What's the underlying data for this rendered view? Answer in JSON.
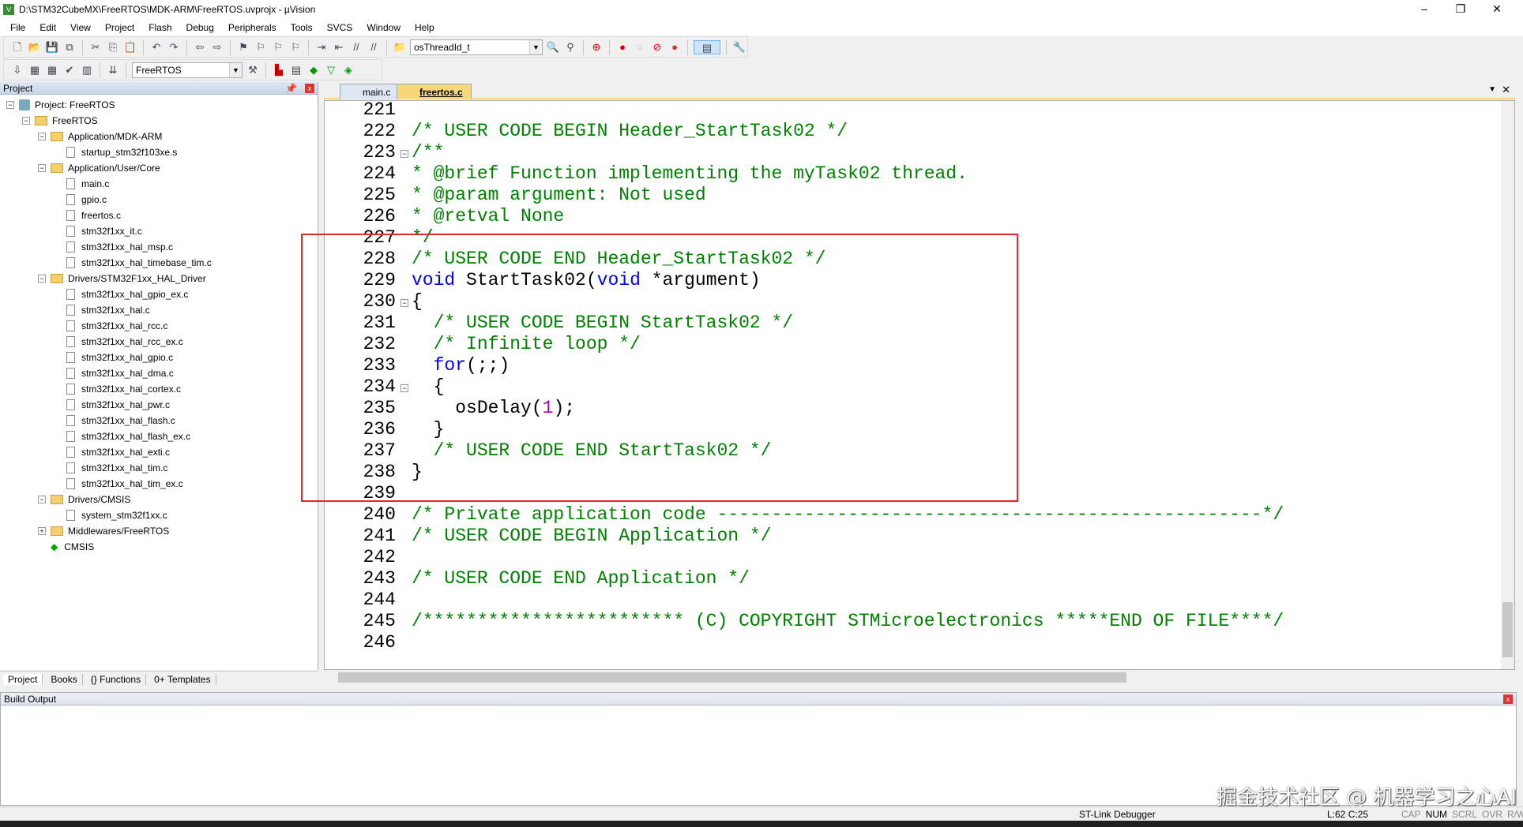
{
  "window": {
    "title": "D:\\STM32CubeMX\\FreeRTOS\\MDK-ARM\\FreeRTOS.uvprojx - µVision"
  },
  "menu": [
    "File",
    "Edit",
    "View",
    "Project",
    "Flash",
    "Debug",
    "Peripherals",
    "Tools",
    "SVCS",
    "Window",
    "Help"
  ],
  "toolbar": {
    "find_combo": "osThreadId_t",
    "target_combo": "FreeRTOS"
  },
  "project_panel": {
    "title": "Project",
    "tree": [
      {
        "label": "Project: FreeRTOS",
        "level": 0,
        "type": "root",
        "toggle": "-"
      },
      {
        "label": "FreeRTOS",
        "level": 1,
        "type": "folder",
        "toggle": "-"
      },
      {
        "label": "Application/MDK-ARM",
        "level": 2,
        "type": "folder",
        "toggle": "-"
      },
      {
        "label": "startup_stm32f103xe.s",
        "level": 3,
        "type": "file"
      },
      {
        "label": "Application/User/Core",
        "level": 2,
        "type": "folder",
        "toggle": "-"
      },
      {
        "label": "main.c",
        "level": 3,
        "type": "file"
      },
      {
        "label": "gpio.c",
        "level": 3,
        "type": "file"
      },
      {
        "label": "freertos.c",
        "level": 3,
        "type": "file"
      },
      {
        "label": "stm32f1xx_it.c",
        "level": 3,
        "type": "file"
      },
      {
        "label": "stm32f1xx_hal_msp.c",
        "level": 3,
        "type": "file"
      },
      {
        "label": "stm32f1xx_hal_timebase_tim.c",
        "level": 3,
        "type": "file"
      },
      {
        "label": "Drivers/STM32F1xx_HAL_Driver",
        "level": 2,
        "type": "folder",
        "toggle": "-"
      },
      {
        "label": "stm32f1xx_hal_gpio_ex.c",
        "level": 3,
        "type": "file"
      },
      {
        "label": "stm32f1xx_hal.c",
        "level": 3,
        "type": "file"
      },
      {
        "label": "stm32f1xx_hal_rcc.c",
        "level": 3,
        "type": "file"
      },
      {
        "label": "stm32f1xx_hal_rcc_ex.c",
        "level": 3,
        "type": "file"
      },
      {
        "label": "stm32f1xx_hal_gpio.c",
        "level": 3,
        "type": "file"
      },
      {
        "label": "stm32f1xx_hal_dma.c",
        "level": 3,
        "type": "file"
      },
      {
        "label": "stm32f1xx_hal_cortex.c",
        "level": 3,
        "type": "file"
      },
      {
        "label": "stm32f1xx_hal_pwr.c",
        "level": 3,
        "type": "file"
      },
      {
        "label": "stm32f1xx_hal_flash.c",
        "level": 3,
        "type": "file"
      },
      {
        "label": "stm32f1xx_hal_flash_ex.c",
        "level": 3,
        "type": "file"
      },
      {
        "label": "stm32f1xx_hal_exti.c",
        "level": 3,
        "type": "file"
      },
      {
        "label": "stm32f1xx_hal_tim.c",
        "level": 3,
        "type": "file"
      },
      {
        "label": "stm32f1xx_hal_tim_ex.c",
        "level": 3,
        "type": "file"
      },
      {
        "label": "Drivers/CMSIS",
        "level": 2,
        "type": "folder",
        "toggle": "-"
      },
      {
        "label": "system_stm32f1xx.c",
        "level": 3,
        "type": "file"
      },
      {
        "label": "Middlewares/FreeRTOS",
        "level": 2,
        "type": "folder",
        "toggle": "+"
      },
      {
        "label": "CMSIS",
        "level": 2,
        "type": "component"
      }
    ],
    "bottom_tabs": [
      "Project",
      "Books",
      "{} Functions",
      "0+ Templates"
    ]
  },
  "editor": {
    "tabs": [
      {
        "label": "main.c",
        "active": false
      },
      {
        "label": "freertos.c",
        "active": true
      }
    ],
    "lines": [
      {
        "n": "221",
        "html": ""
      },
      {
        "n": "222",
        "html": "<span class='cm'>/* USER CODE BEGIN Header_StartTask02 */</span>"
      },
      {
        "n": "223",
        "html": "<span class='cm'>/**</span>",
        "fold": "-"
      },
      {
        "n": "224",
        "html": "<span class='cm'>* @brief Function implementing the myTask02 thread.</span>"
      },
      {
        "n": "225",
        "html": "<span class='cm'>* @param argument: Not used</span>"
      },
      {
        "n": "226",
        "html": "<span class='cm'>* @retval None</span>"
      },
      {
        "n": "227",
        "html": "<span class='cm'>*/</span>"
      },
      {
        "n": "228",
        "html": "<span class='cm'>/* USER CODE END Header_StartTask02 */</span>"
      },
      {
        "n": "229",
        "html": "<span class='kw'>void</span> StartTask02(<span class='kw'>void</span> *argument)"
      },
      {
        "n": "230",
        "html": "{",
        "fold": "-"
      },
      {
        "n": "231",
        "html": "  <span class='cm'>/* USER CODE BEGIN StartTask02 */</span>"
      },
      {
        "n": "232",
        "html": "  <span class='cm'>/* Infinite loop */</span>"
      },
      {
        "n": "233",
        "html": "  <span class='kw'>for</span>(;;)"
      },
      {
        "n": "234",
        "html": "  {",
        "fold": "-"
      },
      {
        "n": "235",
        "html": "    osDelay(<span class='num'>1</span>);"
      },
      {
        "n": "236",
        "html": "  }"
      },
      {
        "n": "237",
        "html": "  <span class='cm'>/* USER CODE END StartTask02 */</span>"
      },
      {
        "n": "238",
        "html": "}"
      },
      {
        "n": "239",
        "html": ""
      },
      {
        "n": "240",
        "html": "<span class='cm'>/* Private application code --------------------------------------------------*/</span>"
      },
      {
        "n": "241",
        "html": "<span class='cm'>/* USER CODE BEGIN Application */</span>"
      },
      {
        "n": "242",
        "html": ""
      },
      {
        "n": "243",
        "html": "<span class='cm'>/* USER CODE END Application */</span>"
      },
      {
        "n": "244",
        "html": ""
      },
      {
        "n": "245",
        "html": "<span class='cm'>/************************ (C) COPYRIGHT STMicroelectronics *****END OF FILE****/</span>"
      },
      {
        "n": "246",
        "html": ""
      }
    ]
  },
  "build_output": {
    "title": "Build Output"
  },
  "status": {
    "debugger": "ST-Link Debugger",
    "position": "L:62 C:25",
    "indicators": [
      "CAP",
      "NUM",
      "SCRL",
      "OVR",
      "R/W"
    ]
  },
  "watermark": "掘金技术社区 @ 机器学习之心AI",
  "colors": {
    "highlight_box": "#e0282e",
    "comment": "#008000",
    "keyword": "#0000ff"
  }
}
